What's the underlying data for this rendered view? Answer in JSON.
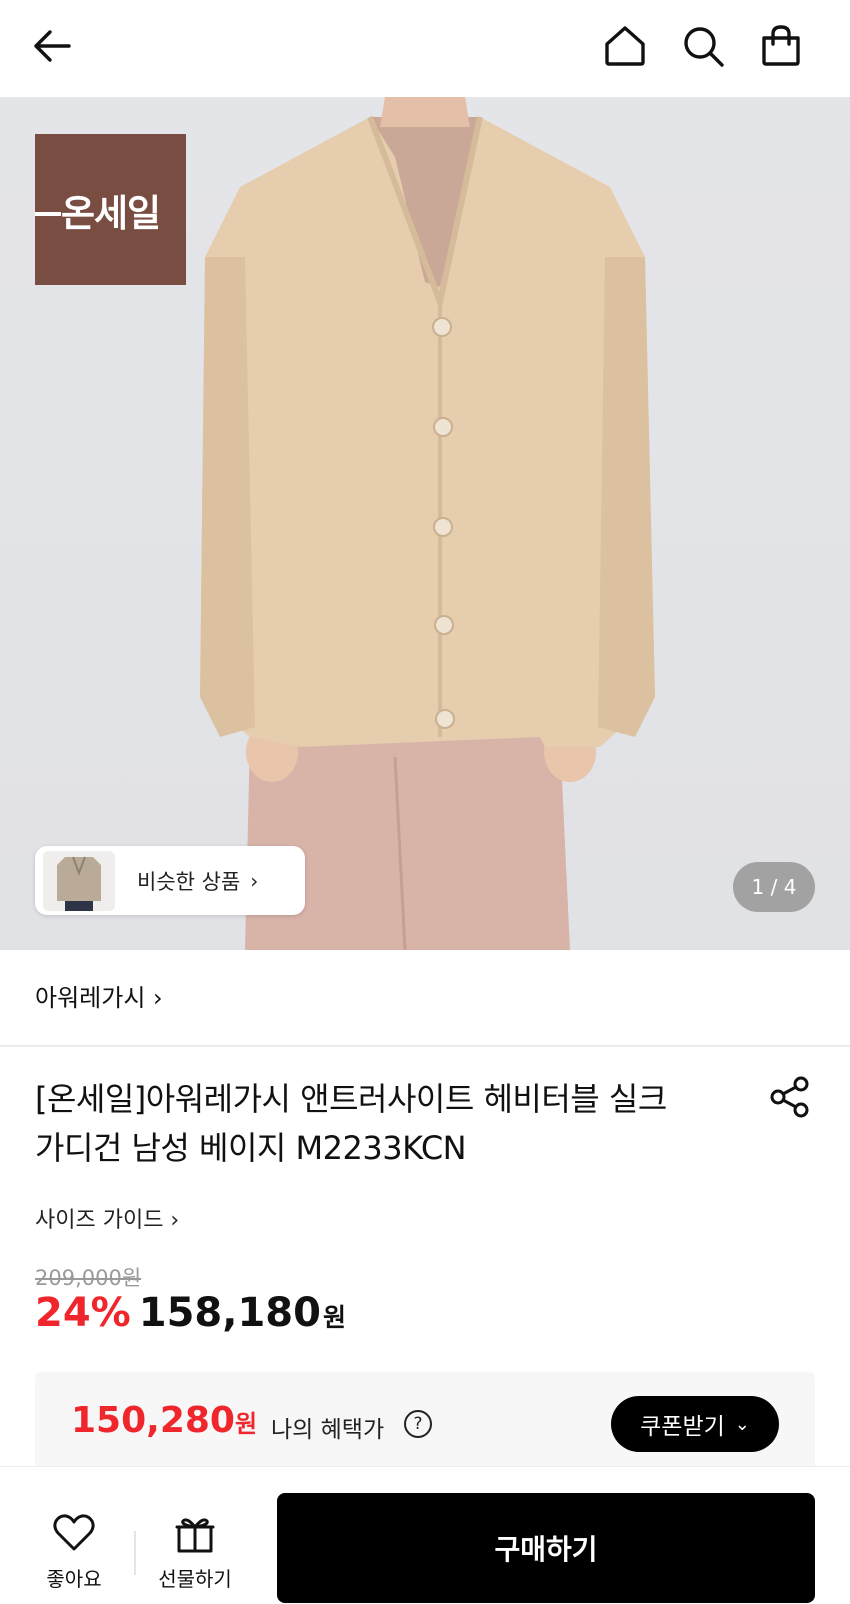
{
  "header": {
    "back_icon": "arrow-left-icon",
    "home_icon": "home-icon",
    "search_icon": "search-icon",
    "cart_icon": "shopping-bag-icon"
  },
  "hero": {
    "badge_text": "온세일",
    "badge_color": "#7a4d43",
    "similar_label": "비슷한 상품",
    "pager": "1 / 4"
  },
  "product": {
    "brand": "아워레가시 ›",
    "title_line1": "[온세일]아워레가시 앤트러사이트 헤비터블 실크",
    "title_line2": "가디건 남성 베이지 M2233KCN",
    "size_guide": "사이즈 가이드 ›",
    "original_price": "209,000원",
    "discount": "24%",
    "price": "158,180",
    "price_unit": "원",
    "accent_color": "#f0262d"
  },
  "benefit": {
    "price": "150,280",
    "price_unit": "원",
    "label": "나의 혜택가",
    "coupon_label": "쿠폰받기"
  },
  "bottom": {
    "like_label": "좋아요",
    "gift_label": "선물하기",
    "buy_label": "구매하기"
  }
}
